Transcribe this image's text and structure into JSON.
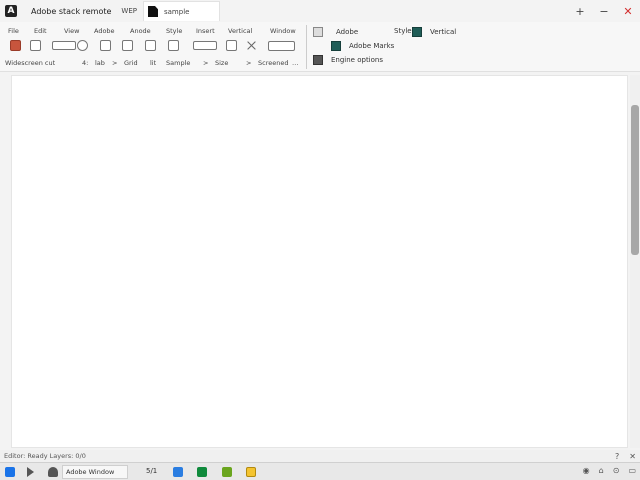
{
  "titlebar": {
    "app_title": "Adobe stack remote",
    "tab_label": "WEP",
    "document_name": "sample",
    "controls": {
      "add": "+",
      "minimize": "−",
      "close": "✕"
    }
  },
  "ribbon": {
    "row1": [
      "File",
      "Edit",
      "View",
      "Adobe",
      "Anode",
      "Style",
      "Insert",
      "Vertical",
      "Window"
    ],
    "row3": [
      "Widescreen cut",
      "4:",
      "lab",
      ">",
      "Grid",
      "lit",
      "Sample",
      ">",
      "Size",
      ">",
      "Screened",
      "…"
    ],
    "right_items": [
      {
        "label": "Adobe",
        "icon": "gray-square-icon"
      },
      {
        "label": "Style",
        "icon": "none"
      },
      {
        "label": "Vertical",
        "icon": "teal-square-icon"
      },
      {
        "label": "Adobe Marks",
        "icon": "teal-square-icon"
      },
      {
        "label": "Engine options",
        "icon": "dark-square-icon"
      }
    ]
  },
  "statusbar": {
    "text": "Editor: Ready  Layers: 0/0",
    "icons": {
      "help": "?",
      "close": "✕"
    }
  },
  "taskbar": {
    "app_label": "Adobe Window",
    "counter": "5/1",
    "tray": [
      "◉",
      "⌂",
      "⊙",
      "▭"
    ]
  },
  "colors": {
    "accent_active": "#c8553d",
    "teal": "#1f5d57",
    "close_red": "#d32f2f"
  }
}
